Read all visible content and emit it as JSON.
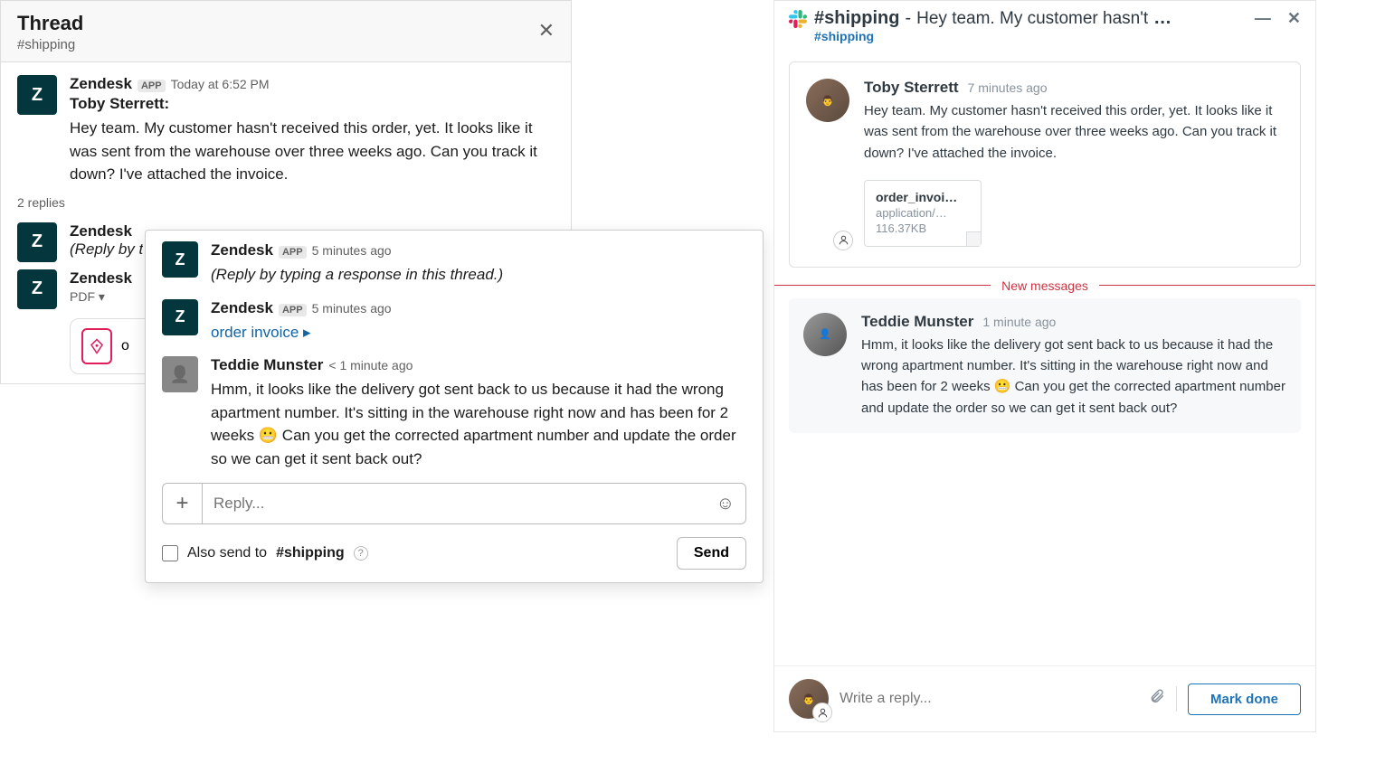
{
  "slack": {
    "header": {
      "title": "Thread",
      "channel": "#shipping"
    },
    "main_msg": {
      "author": "Zendesk",
      "app": "APP",
      "time": "Today at 6:52 PM",
      "subauthor": "Toby Sterrett:",
      "text": "Hey team. My customer hasn't received this order, yet. It looks like it was sent from the warehouse over three weeks ago. Can you track it down? I've attached the invoice."
    },
    "replies_label": "2 replies",
    "truncated": [
      {
        "author": "Zendesk",
        "line": "(Reply by t"
      },
      {
        "author": "Zendesk",
        "line": "PDF ▾"
      }
    ],
    "pdf_card_label": "o",
    "popup": {
      "msgs": [
        {
          "author": "Zendesk",
          "app": "APP",
          "time": "5 minutes ago",
          "text": "(Reply by typing a response in this thread.)",
          "italic": true,
          "avatar": "zd"
        },
        {
          "author": "Zendesk",
          "app": "APP",
          "time": "5 minutes ago",
          "text": "order invoice ▸",
          "avatar": "zd"
        },
        {
          "author": "Teddie Munster",
          "time": "< 1 minute ago",
          "text": "Hmm, it looks like the delivery got sent back to us because it had the wrong apartment number. It's sitting in the warehouse right now and has been for 2 weeks 😬 Can you get the corrected apartment number and update the order so we can get it sent back out?",
          "avatar": "photo"
        }
      ],
      "reply_placeholder": "Reply...",
      "also_send": "Also send to",
      "also_channel": "#shipping",
      "send": "Send"
    }
  },
  "zd": {
    "title_channel": "#shipping",
    "title_sep": "-",
    "title_preview": "Hey team. My customer hasn't",
    "title_dots": "…",
    "sub_channel": "#shipping",
    "card1": {
      "author": "Toby Sterrett",
      "time": "7 minutes ago",
      "text": "Hey team. My customer hasn't received this order, yet. It looks like it was sent from the warehouse over three weeks ago. Can you track it down? I've attached the invoice.",
      "file": {
        "name": "order_invoi…",
        "type": "application/…",
        "size": "116.37KB"
      }
    },
    "new_messages": "New messages",
    "card2": {
      "author": "Teddie Munster",
      "time": "1 minute ago",
      "text": "Hmm, it looks like the delivery got sent back to us because it had the wrong apartment number. It's sitting in the warehouse right now and has been for 2 weeks 😬 Can you get the corrected apartment number and update the order so we can get it sent back out?"
    },
    "reply_placeholder": "Write a reply...",
    "mark_done": "Mark done"
  }
}
